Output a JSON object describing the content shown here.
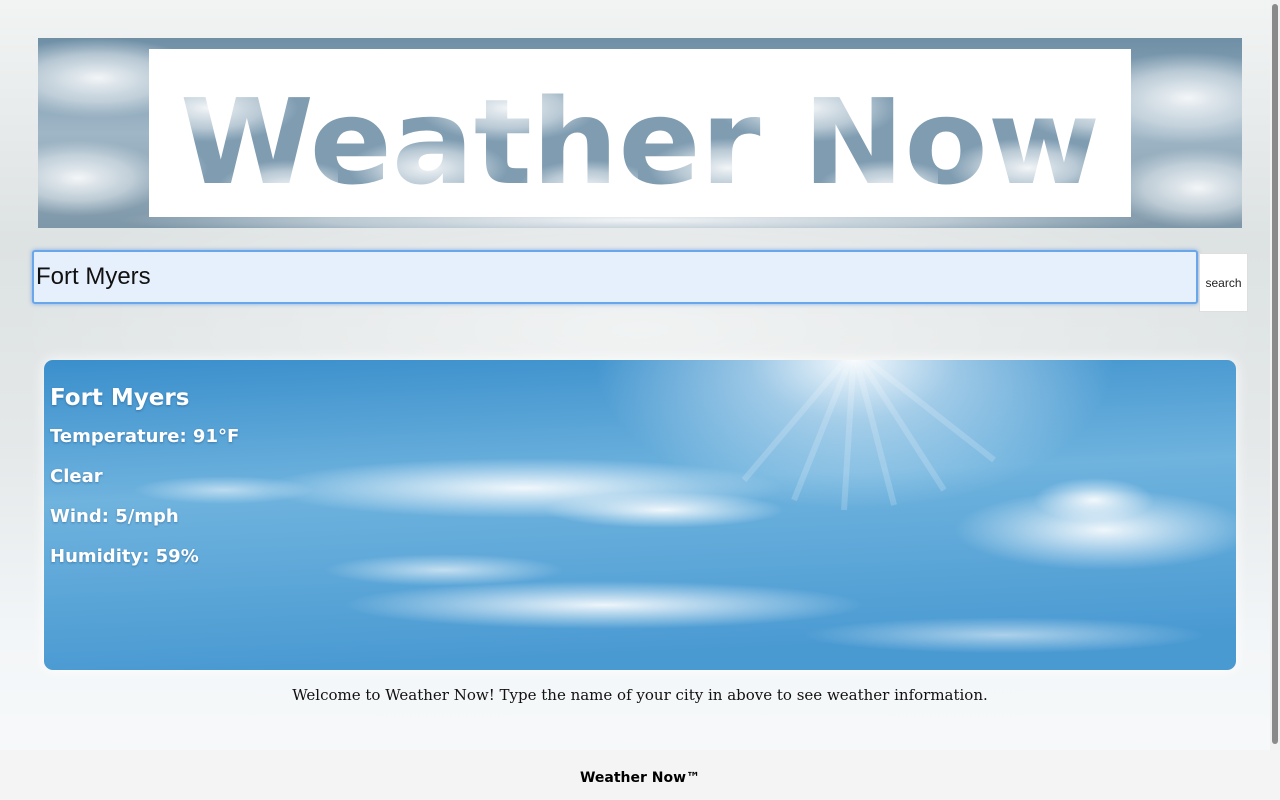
{
  "header": {
    "logo_text": "Weather Now"
  },
  "search": {
    "value": "Fort Myers",
    "button_label": "search"
  },
  "weather": {
    "city": "Fort Myers",
    "temperature": "Temperature: 91°F",
    "condition": "Clear",
    "wind": "Wind: 5/mph",
    "humidity": "Humidity: 59%"
  },
  "welcome_text": "Welcome to Weather Now! Type the name of your city in above to see weather information.",
  "footer": {
    "text": "Weather Now™"
  },
  "colors": {
    "input_focus": "#6aa6ea",
    "card_sky": "#4a9ed4"
  }
}
